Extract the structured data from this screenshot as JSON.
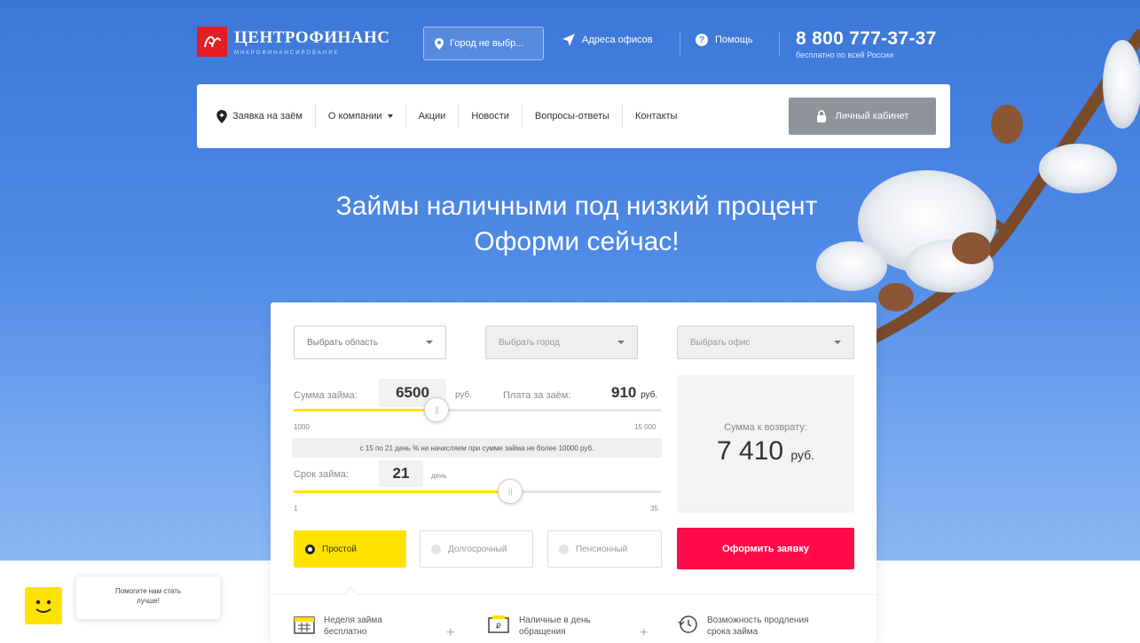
{
  "brand": {
    "name": "ЦЕНТРОФИНАНС",
    "subtitle": "МИКРОФИНАНСИРОВАНИЕ",
    "color": "#e31e24"
  },
  "topbar": {
    "city_button": "Город не выбр...",
    "offices_link": "Адреса офисов",
    "help_link": "Помощь",
    "phone": "8 800 777-37-37",
    "phone_note": "бесплатно по всей России"
  },
  "nav": {
    "items": [
      "Заявка на заём",
      "О компании",
      "Акции",
      "Новости",
      "Вопросы-ответы",
      "Контакты"
    ],
    "cabinet": "Личный кабинет"
  },
  "hero": {
    "line1": "Займы наличными под низкий процент",
    "line2": "Оформи сейчас!"
  },
  "calculator": {
    "selects": {
      "region": "Выбрать область",
      "city": "Выбрать город",
      "office": "Выбрать офис"
    },
    "amount": {
      "label": "Сумма займа:",
      "value": "6500",
      "unit": "руб.",
      "min": "1000",
      "max": "15 000",
      "position": 0.39
    },
    "fee": {
      "label": "Плата за заём:",
      "value": "910",
      "unit": "руб."
    },
    "note": "с 15 по 21 день % не начисляем при сумме займа не более 10000 руб.",
    "term": {
      "label": "Срок займа:",
      "value": "21",
      "unit": "день",
      "min": "1",
      "max": "35",
      "position": 0.59
    },
    "total": {
      "label": "Сумма к возврату:",
      "value": "7 410",
      "unit": "руб."
    },
    "types": [
      "Простой",
      "Долгосрочный",
      "Пенсионный"
    ],
    "active_type": "Простой",
    "submit": "Оформить заявку",
    "accent_yellow": "#ffe300",
    "accent_red": "#ff0b4a"
  },
  "features": [
    {
      "icon": "calendar-icon",
      "line1": "Неделя займа",
      "line2": "бесплатно"
    },
    {
      "icon": "cash-icon",
      "line1": "Наличные в день",
      "line2": "обращения"
    },
    {
      "icon": "extend-icon",
      "line1": "Возможность продления",
      "line2": "срока займа"
    }
  ],
  "feedback": {
    "line1": "Помогите нам стать",
    "line2": "лучше!"
  }
}
